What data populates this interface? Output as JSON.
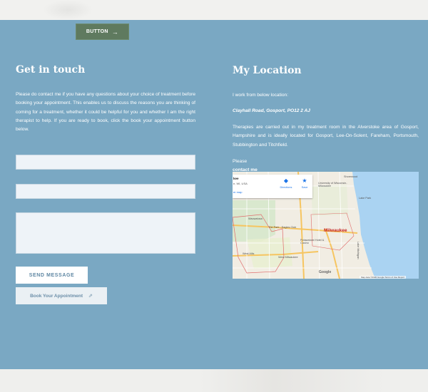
{
  "top_button": {
    "label": "BUTTON",
    "icon": "arrow-right-icon"
  },
  "contact": {
    "heading": "Get in touch",
    "paragraph": "Please do contact me if you have any questions about your choice of treatment before booking your appointment. This enables us to discuss the reasons you are thinking of coming for a treatment, whether it could be helpful for you and whether I am the right therapist to help. If you are ready to book, click the book your appointment button below.",
    "send_label": "SEND MESSAGE",
    "book_label": "Book Your Appointment",
    "book_icon": "external-link-icon"
  },
  "location": {
    "heading": "My Location",
    "intro": "I work from below location:",
    "address": "Clayhall Road, Gosport, PO12 2 AJ",
    "body": "Therapies are carried out in my treatment room in the Alverstoke area of Gosport, Hampshire and is ideally located for Gosport, Lee-On-Solent, Fareham, Portsmouth, Stubbington and Titchfield.",
    "please": "Please",
    "link": "contact me"
  },
  "map": {
    "card_title": "kee",
    "card_sub": "e, WI, USA",
    "card_link": "er map",
    "directions": "Directions",
    "save": "Save",
    "city": "Milwaukee",
    "labels": {
      "shorewood": "Shorewood",
      "university": "University of Wisconsin-Milwaukee",
      "lake_park": "Lake Park",
      "wauwatosa": "Wauwatosa",
      "the_park": "The Park - Eagles Club",
      "potawatomi": "Potawatomi Hotel & Casino",
      "west_allis": "West Allis",
      "west_milwaukee": "West Milwaukee",
      "lake": "Lake Michigan"
    },
    "google": "Google",
    "footer": "Map data ©2020 Google   Terms of Use   Report"
  },
  "colors": {
    "background": "#7aa8c3",
    "top_button": "#5f7a5f",
    "field": "#eef3f8",
    "accent_text": "#5f87a3"
  }
}
